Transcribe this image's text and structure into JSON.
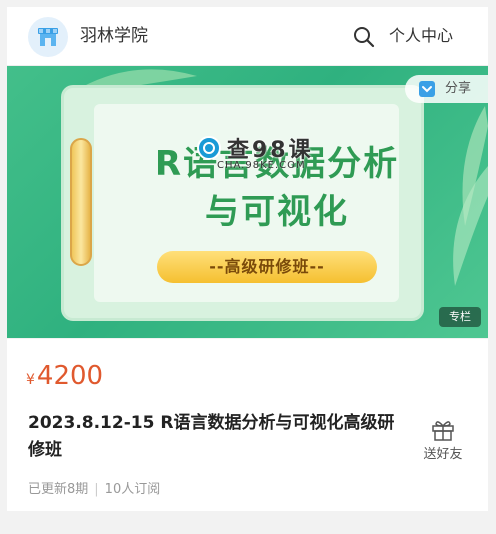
{
  "header": {
    "site_name": "羽林学院",
    "user_center": "个人中心",
    "icons": {
      "logo": "shop-icon",
      "search": "search-icon"
    }
  },
  "banner": {
    "title_line1": "R语言数据分析",
    "title_line2": "与可视化",
    "ribbon": "--高级研修班--",
    "watermark": {
      "text": "查98课",
      "sub": "CHA.98KE.COM"
    },
    "share_label": "分享",
    "column_tag": "专栏"
  },
  "course": {
    "currency": "¥",
    "price": "4200",
    "title": "2023.8.12-15 R语言数据分析与可视化高级研修班",
    "gift_label": "送好友",
    "updated": "已更新8期",
    "subscribers": "10人订阅"
  },
  "colors": {
    "accent": "#e0592e",
    "banner_green": "#2fb17f",
    "title_green": "#2f9b54"
  }
}
